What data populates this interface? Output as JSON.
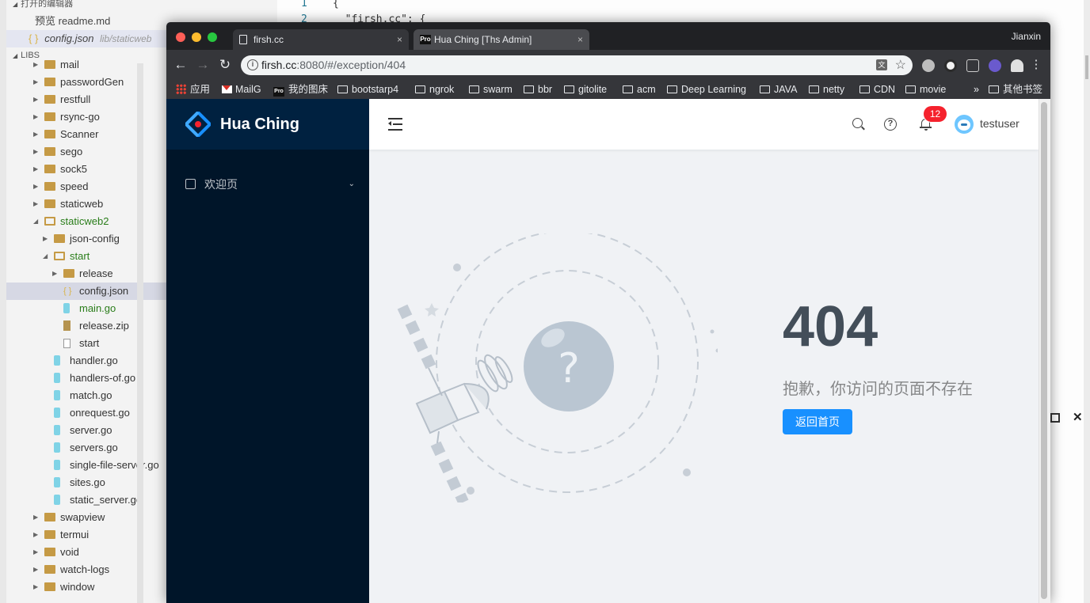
{
  "editor": {
    "open_editors_header": "打开的编辑器",
    "open_files": [
      "预览 readme.md",
      "config.json"
    ],
    "open_file_path": "lib/staticweb",
    "libs_header": "LIBS",
    "tree": [
      {
        "label": "mail",
        "kind": "folder",
        "depth": 0
      },
      {
        "label": "passwordGen",
        "kind": "folder",
        "depth": 0
      },
      {
        "label": "restfull",
        "kind": "folder",
        "depth": 0
      },
      {
        "label": "rsync-go",
        "kind": "folder",
        "depth": 0
      },
      {
        "label": "Scanner",
        "kind": "folder",
        "depth": 0
      },
      {
        "label": "sego",
        "kind": "folder",
        "depth": 0
      },
      {
        "label": "sock5",
        "kind": "folder",
        "depth": 0
      },
      {
        "label": "speed",
        "kind": "folder",
        "depth": 0
      },
      {
        "label": "staticweb",
        "kind": "folder",
        "depth": 0
      },
      {
        "label": "staticweb2",
        "kind": "folder-open",
        "depth": 0
      },
      {
        "label": "json-config",
        "kind": "folder",
        "depth": 1
      },
      {
        "label": "start",
        "kind": "folder-open",
        "depth": 1
      },
      {
        "label": "release",
        "kind": "folder",
        "depth": 2
      },
      {
        "label": "config.json",
        "kind": "json",
        "depth": 2
      },
      {
        "label": "main.go",
        "kind": "go",
        "depth": 2
      },
      {
        "label": "release.zip",
        "kind": "zip",
        "depth": 2
      },
      {
        "label": "start",
        "kind": "plain",
        "depth": 2
      },
      {
        "label": "handler.go",
        "kind": "go",
        "depth": 1
      },
      {
        "label": "handlers-of.go",
        "kind": "go",
        "depth": 1
      },
      {
        "label": "match.go",
        "kind": "go",
        "depth": 1
      },
      {
        "label": "onrequest.go",
        "kind": "go",
        "depth": 1
      },
      {
        "label": "server.go",
        "kind": "go",
        "depth": 1
      },
      {
        "label": "servers.go",
        "kind": "go",
        "depth": 1
      },
      {
        "label": "single-file-server.go",
        "kind": "go",
        "depth": 1
      },
      {
        "label": "sites.go",
        "kind": "go",
        "depth": 1
      },
      {
        "label": "static_server.go",
        "kind": "go",
        "depth": 1
      },
      {
        "label": "swapview",
        "kind": "folder",
        "depth": 0
      },
      {
        "label": "termui",
        "kind": "folder",
        "depth": 0
      },
      {
        "label": "void",
        "kind": "folder",
        "depth": 0
      },
      {
        "label": "watch-logs",
        "kind": "folder",
        "depth": 0
      },
      {
        "label": "window",
        "kind": "folder",
        "depth": 0
      }
    ],
    "code_lines": [
      {
        "num": "1",
        "text": "{"
      },
      {
        "num": "2",
        "text": "  \"firsh.cc\": {"
      }
    ]
  },
  "browser": {
    "tabs": [
      {
        "label": "firsh.cc",
        "close": "×"
      },
      {
        "label": "Hua Ching [Ths Admin]",
        "close": "×"
      }
    ],
    "profile": "Jianxin",
    "url_host": "firsh.cc",
    "url_rest": ":8080/#/exception/404",
    "bookmarks": [
      "应用",
      "MailG",
      "我的图床",
      "bootstarp4",
      "ngrok",
      "swarm",
      "bbr",
      "gitolite",
      "acm",
      "Deep Learning",
      "JAVA",
      "netty",
      "CDN",
      "movie"
    ],
    "bookmarks_more": "»",
    "other_bookmarks": "其他书签"
  },
  "app": {
    "logo_text": "Hua Ching",
    "menu_item": "欢迎页",
    "notification_count": "12",
    "username": "testuser",
    "brand_color": "#1890ff",
    "sider_color": "#001529",
    "exception": {
      "title": "404",
      "description": "抱歉，你访问的页面不存在",
      "back_button": "返回首页"
    }
  }
}
